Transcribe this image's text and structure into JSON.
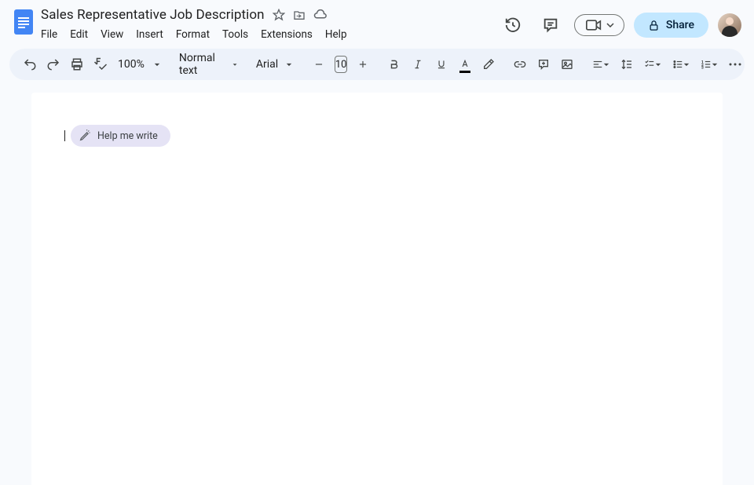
{
  "document": {
    "title": "Sales Representative Job Description"
  },
  "menus": {
    "file": "File",
    "edit": "Edit",
    "view": "View",
    "insert": "Insert",
    "format": "Format",
    "tools": "Tools",
    "extensions": "Extensions",
    "help": "Help"
  },
  "header": {
    "share_label": "Share"
  },
  "toolbar": {
    "zoom": "100%",
    "style": "Normal text",
    "font": "Arial",
    "font_size": "10"
  },
  "assist": {
    "help_write": "Help me write"
  }
}
